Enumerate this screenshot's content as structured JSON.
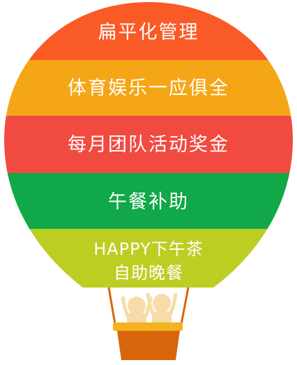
{
  "balloon": {
    "bands": [
      {
        "label": "扁平化管理",
        "color": "#f95a26"
      },
      {
        "label": "体育娱乐一应俱全",
        "color": "#f5a616"
      },
      {
        "label": "每月团队活动奖金",
        "color": "#f04a41"
      },
      {
        "label": "午餐补助",
        "color": "#10a848"
      },
      {
        "label_line1": "HAPPY下午茶",
        "label_line2": "自助晚餐",
        "color": "#bcce22"
      }
    ],
    "basket_color": "#d9650a",
    "rim_color": "#f3b321",
    "rope_color": "#d9650a"
  }
}
